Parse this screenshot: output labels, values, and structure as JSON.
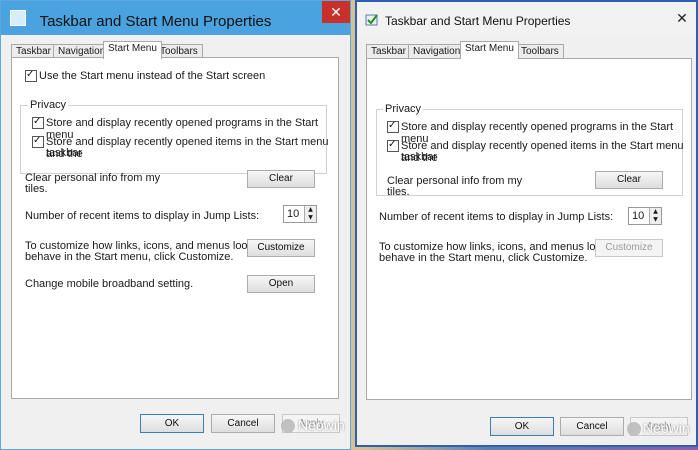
{
  "left_window": {
    "title": "Taskbar and Start Menu Properties",
    "close_glyph": "✕",
    "tabs": [
      "Taskbar",
      "Navigation",
      "Start Menu",
      "Toolbars"
    ],
    "use_start_menu_label": "Use the Start menu instead of the Start screen",
    "privacy_label": "Privacy",
    "store_programs_label": "Store and display recently opened programs in the Start menu",
    "store_items_label_line1": "Store and display recently opened items in the Start menu and the",
    "store_items_label_line2": "taskbar",
    "clear_info_line1": "Clear personal info from my",
    "clear_info_line2": "tiles.",
    "clear_button": "Clear",
    "jump_lists_label": "Number of recent items to display in Jump Lists:",
    "jump_lists_value": "10",
    "customize_line1": "To customize how links, icons, and menus look and",
    "customize_line2": "behave in the Start menu, click Customize.",
    "customize_button": "Customize",
    "broadband_label": "Change mobile broadband setting.",
    "open_button": "Open",
    "ok_button": "OK",
    "cancel_button": "Cancel",
    "apply_button": "Apply"
  },
  "right_window": {
    "title": "Taskbar and Start Menu Properties",
    "close_glyph": "✕",
    "tabs": [
      "Taskbar",
      "Navigation",
      "Start Menu",
      "Toolbars"
    ],
    "privacy_label": "Privacy",
    "store_programs_label": "Store and display recently opened programs in the Start menu",
    "store_items_label_line1": "Store and display recently opened items in the Start menu and the",
    "store_items_label_line2": "taskbar",
    "clear_info_line1": "Clear personal info from my",
    "clear_info_line2": "tiles.",
    "clear_button": "Clear",
    "jump_lists_label": "Number of recent items to display in Jump Lists:",
    "jump_lists_value": "10",
    "customize_line1": "To customize how links, icons, and menus look and",
    "customize_line2": "behave in the Start menu, click Customize.",
    "customize_button": "Customize",
    "ok_button": "OK",
    "cancel_button": "Cancel",
    "apply_button": "Apply"
  },
  "watermark": "Neowin",
  "colors": {
    "left_titlebar": "#4aa3df",
    "close_red": "#c7302b",
    "right_border": "#2f5fb0"
  }
}
